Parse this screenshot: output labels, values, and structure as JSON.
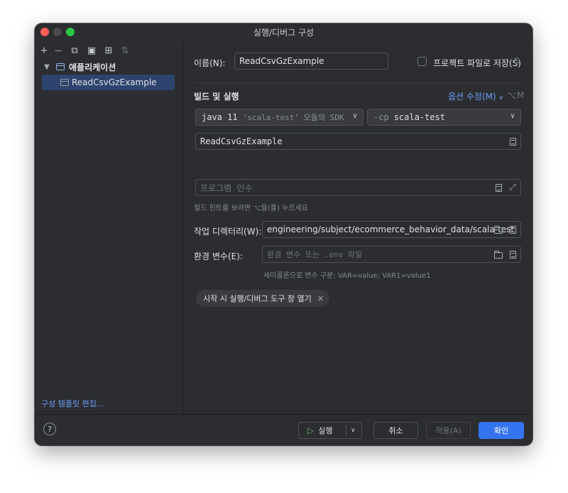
{
  "window": {
    "title": "실행/디버그 구성"
  },
  "sidebar": {
    "toolbar": [
      {
        "name": "add-icon",
        "glyph": "+"
      },
      {
        "name": "remove-icon",
        "glyph": "—"
      },
      {
        "name": "copy-icon",
        "glyph": "⧉"
      },
      {
        "name": "save-icon",
        "glyph": "▣"
      },
      {
        "name": "new-folder-icon",
        "glyph": "⊞"
      },
      {
        "name": "sort-icon",
        "glyph": "⇅"
      }
    ],
    "group_label": "애플리케이션",
    "selected_item": "ReadCsvGzExample",
    "edit_templates": "구성 템플릿 편집..."
  },
  "form": {
    "name_label": "이름(N):",
    "name_value": "ReadCsvGzExample",
    "store_as_file": "프로젝트 파일로 저장(S)",
    "build_run_heading": "빌드 및 실행",
    "modify_options": "옵션 수정(M)",
    "modify_shortcut": "⌥M",
    "jdk_prefix": "java 11",
    "jdk_suffix": "'scala-test' 모듈의 SDK",
    "cp_prefix": "-cp",
    "cp_value": "scala-test",
    "main_class": "ReadCsvGzExample",
    "program_args_placeholder": "프로그램 인수",
    "build_hint": "필드 힌트를 보려면 ⌥을(를) 누르세요",
    "workdir_label": "작업 디렉터리(W):",
    "workdir_value": "engineering/subject/ecommerce_behavior_data/scala-test",
    "env_label": "환경 변수(E):",
    "env_placeholder": "환경 변수 또는 .env 파일",
    "env_hint": "세미콜론으로 변수 구분: VAR=value; VAR1=value1",
    "chip_label": "시작 시 실행/디버그 도구 창 열기"
  },
  "footer": {
    "help": "?",
    "run": "실행",
    "cancel": "취소",
    "apply": "적용(A)",
    "ok": "확인"
  },
  "colors": {
    "window_bg": "#2b2d30",
    "accent": "#3574f0",
    "link": "#6d9ef8",
    "selection": "#2e436e"
  }
}
